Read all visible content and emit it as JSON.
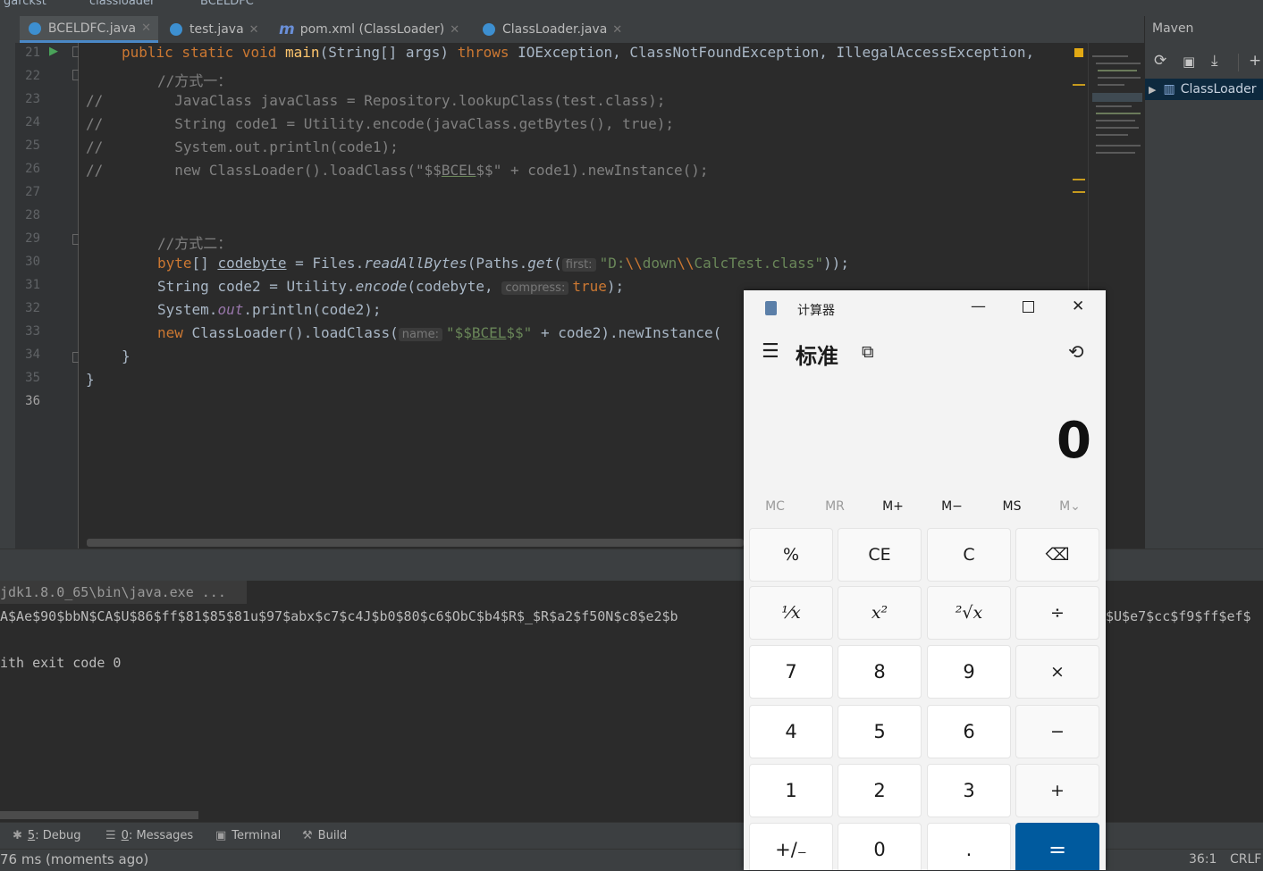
{
  "breadcrumb": [
    "garckst",
    "classloader",
    "BCELDFC"
  ],
  "tabs": [
    {
      "label": "BCELDFC.java",
      "icon": "java-class-icon",
      "color": "#3d8fd0",
      "active": true
    },
    {
      "label": "test.java",
      "icon": "java-class-icon",
      "color": "#3d8fd0",
      "active": false
    },
    {
      "label": "pom.xml (ClassLoader)",
      "icon": "maven-m-icon",
      "color": "#6a8fd8",
      "active": false
    },
    {
      "label": "ClassLoader.java",
      "icon": "java-class-icon",
      "color": "#3d8fd0",
      "active": false
    }
  ],
  "line_numbers": [
    "21",
    "22",
    "23",
    "24",
    "25",
    "26",
    "27",
    "28",
    "29",
    "30",
    "31",
    "32",
    "33",
    "34",
    "35",
    "36"
  ],
  "code": {
    "l21": {
      "a": "public static void ",
      "b": "main",
      "c": "(String[] args) ",
      "d": "throws ",
      "e": "IOException, ClassNotFoundException, IllegalAccessException,"
    },
    "l22": "//方式一：",
    "l23": {
      "slash": "//",
      "text": "JavaClass javaClass = Repository.lookupClass(test.class);"
    },
    "l24": {
      "slash": "//",
      "text": "String code1 = Utility.encode(javaClass.getBytes(), true);"
    },
    "l25": {
      "slash": "//",
      "text": "System.out.println(code1);"
    },
    "l26": {
      "slash": "//",
      "a": "new ClassLoader().loadClass(\"$$",
      "b": "BCEL",
      "c": "$$\" + code1).newInstance();"
    },
    "l29": "//方式二：",
    "l30": {
      "a": "byte",
      "b": "[] ",
      "c": "codebyte",
      "d": " = Files.",
      "e": "readAllBytes",
      "f": "(Paths.",
      "g": "get",
      "h": "(",
      "hint": "first:",
      "s1": "\"D:",
      "s2": "\\\\",
      "s3": "down",
      "s4": "\\\\",
      "s5": "CalcTest.class\"",
      "end": "));"
    },
    "l31": {
      "a": "String code2 = Utility.",
      "b": "encode",
      "c": "(codebyte, ",
      "hint": "compress:",
      "d": "true",
      "e": ");"
    },
    "l32": {
      "a": "System.",
      "b": "out",
      "c": ".println(code2);"
    },
    "l33": {
      "a": "new ",
      "b": "ClassLoader().loadClass(",
      "hint": "name:",
      "s1": "\"$$",
      "s2": "BCEL",
      "s3": "$$\"",
      "d": " + code2).newInstance("
    },
    "l34": "}",
    "l35": "}"
  },
  "maven": {
    "title": "Maven",
    "tree_item": "ClassLoader"
  },
  "run_output": {
    "line1": "jdk1.8.0_65\\bin\\java.exe ...",
    "line2": "A$Ae$90$bbN$CA$U$86$ff$81$85$81u$97$abx$c7$c4J$b0$80$c6$ObC$b4$R$_$R$a2$f50N$c8$e2$b",
    "line2_tail": "$U$e7$cc$f9$ff$ef$",
    "line3": "ith exit code 0"
  },
  "toolwindows": [
    {
      "key": "5",
      "label": ": Debug",
      "icon": "bug-icon"
    },
    {
      "key": "0",
      "label": ": Messages",
      "icon": "messages-icon"
    },
    {
      "key": "",
      "label": "Terminal",
      "icon": "terminal-icon"
    },
    {
      "key": "",
      "label": "Build",
      "icon": "hammer-icon"
    }
  ],
  "status": {
    "message": "76 ms (moments ago)",
    "position": "36:1",
    "line_sep": "CRLF"
  },
  "calculator": {
    "window_title": "计算器",
    "mode": "标准",
    "display": "0",
    "memory": [
      "MC",
      "MR",
      "M+",
      "M−",
      "MS",
      "M⌄"
    ],
    "keys": [
      [
        "%",
        "CE",
        "C",
        "⌫"
      ],
      [
        "¹⁄x",
        "x²",
        "²√x",
        "÷"
      ],
      [
        "7",
        "8",
        "9",
        "×"
      ],
      [
        "4",
        "5",
        "6",
        "−"
      ],
      [
        "1",
        "2",
        "3",
        "+"
      ],
      [
        "+/₋",
        "0",
        ".",
        "="
      ]
    ]
  }
}
